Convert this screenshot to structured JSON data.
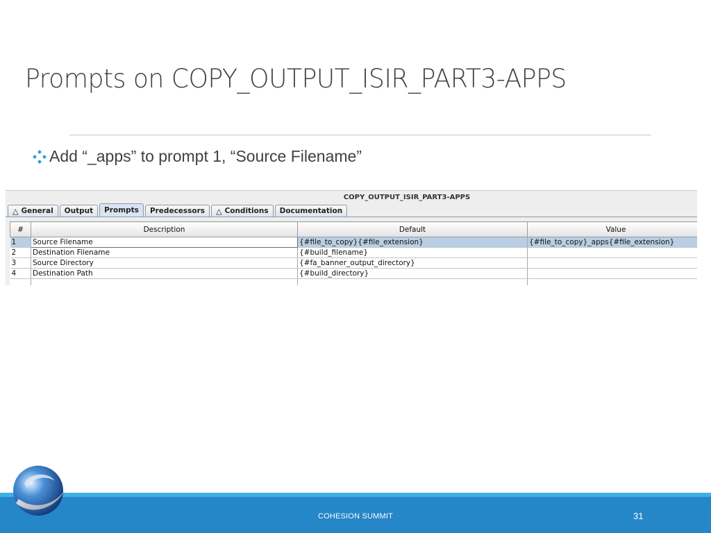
{
  "slide": {
    "title": "Prompts on COPY_OUTPUT_ISIR_PART3-APPS",
    "bullet": "Add “_apps” to prompt 1, “Source Filename”"
  },
  "app": {
    "window_title": "COPY_OUTPUT_ISIR_PART3-APPS",
    "tabs": [
      {
        "label": "General",
        "icon": "warning-triangle-icon"
      },
      {
        "label": "Output"
      },
      {
        "label": "Prompts",
        "active": true
      },
      {
        "label": "Predecessors"
      },
      {
        "label": "Conditions",
        "icon": "warning-triangle-icon"
      },
      {
        "label": "Documentation"
      }
    ],
    "columns": [
      "#",
      "Description",
      "Default",
      "Value"
    ],
    "rows": [
      {
        "num": "1",
        "description": "Source Filename",
        "default": "{#file_to_copy}{#file_extension}",
        "value": "{#file_to_copy}_apps{#file_extension}"
      },
      {
        "num": "2",
        "description": "Destination Filename",
        "default": "{#build_filename}",
        "value": ""
      },
      {
        "num": "3",
        "description": "Source Directory",
        "default": "{#fa_banner_output_directory}",
        "value": ""
      },
      {
        "num": "4",
        "description": "Destination Path",
        "default": "{#build_directory}",
        "value": ""
      }
    ],
    "selected_row": 1
  },
  "footer": {
    "text": "COHESION SUMMIT",
    "page_number": "31"
  },
  "colors": {
    "footer_bg": "#2586c8",
    "footer_strip": "#3eb0e8",
    "selected_row": "#b8cfe5",
    "bullet_icon": "#2a9fd8"
  }
}
